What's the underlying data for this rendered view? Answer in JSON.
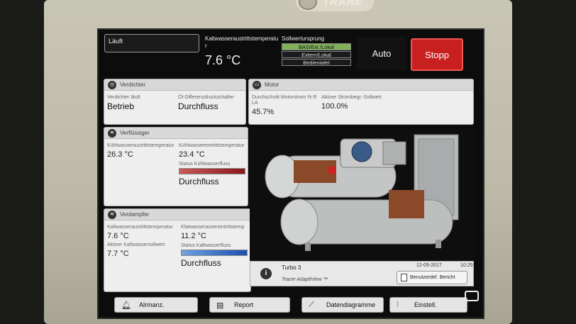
{
  "device": {
    "brand": "TRANE"
  },
  "header": {
    "status": "Läuft",
    "leaving_water_label": "Kaltwasseraustrittstemperatur",
    "leaving_water_value": "7.6 °C",
    "setpoint_source": {
      "title": "Sollwertursprung",
      "options": [
        "BAS/Ext./Lokal",
        "Extern/Lokal",
        "Bedientafel"
      ],
      "active_index": 0
    },
    "auto_label": "Auto",
    "stop_label": "Stopp"
  },
  "verdichter": {
    "title": "Verdichter",
    "running_label": "Verdichter läuft",
    "running_value": "Betrieb",
    "oil_label": "Öl-Differenzdruckschalter",
    "oil_value": "Durchfluss"
  },
  "motor": {
    "title": "Motor",
    "avg_current_label": "Durchschnitt Motorstrom % RLA",
    "avg_current_value": "45.7%",
    "current_limit_label": "Aktiver Strombegr.-Sollwert",
    "current_limit_value": "100.0%"
  },
  "verfluessiger": {
    "title": "Verflüssiger",
    "outlet_label": "Kühlwasseraustrittstemperatur",
    "outlet_value": "26.3 °C",
    "inlet_label": "Kühlwassereintrittstemperatur",
    "inlet_value": "23.4 °C",
    "flow_status_label": "Status Kühlwasserfluss",
    "flow_value": "Durchfluss"
  },
  "verdampfer": {
    "title": "Verdampfer",
    "outlet_label": "Kaltwasseraustrittstemperatur",
    "outlet_value": "7.6 °C",
    "setpoint_label": "Aktiver Kaltwassersollwert",
    "setpoint_value": "7.7 °C",
    "inlet_label": "Klatwasserassereintrittstemp",
    "inlet_value": "11.2 °C",
    "flow_status_label": "Status Kaltwasserfluss",
    "flow_value": "Durchfluss"
  },
  "info": {
    "unit_name": "Turbo 3",
    "product": "Tracer AdaptiView ™",
    "date": "12-05-2017",
    "time": "10:25",
    "report_button": "Benutzerdef. Bericht"
  },
  "nav": {
    "alarms": "Alrmanz.",
    "report": "Report",
    "trends": "Datendiagramme",
    "settings": "Einstell."
  }
}
